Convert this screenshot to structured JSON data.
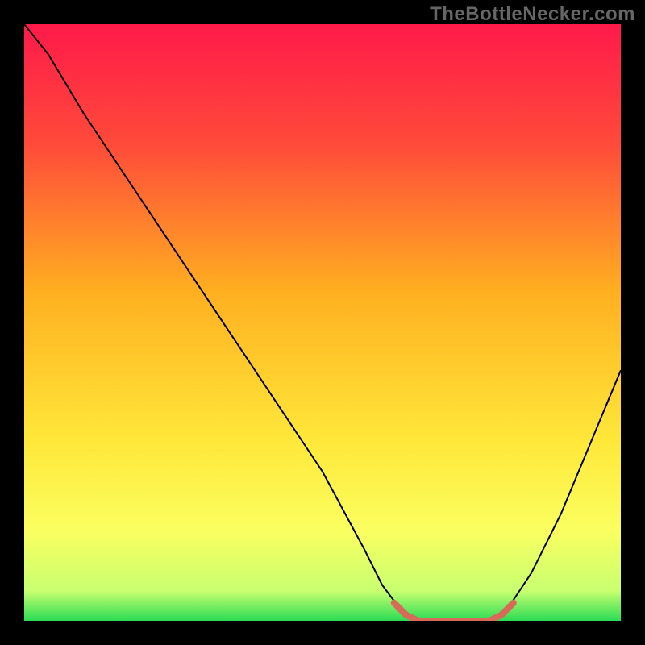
{
  "watermark": "TheBottleNecker.com",
  "chart_data": {
    "type": "line",
    "title": "",
    "xlabel": "",
    "ylabel": "",
    "xlim": [
      0,
      100
    ],
    "ylim": [
      0,
      100
    ],
    "gradient_stops": [
      {
        "offset": 0,
        "color": "#ff1a4a"
      },
      {
        "offset": 20,
        "color": "#ff4a3a"
      },
      {
        "offset": 45,
        "color": "#ffb020"
      },
      {
        "offset": 70,
        "color": "#ffe83a"
      },
      {
        "offset": 85,
        "color": "#faff60"
      },
      {
        "offset": 95,
        "color": "#c8ff70"
      },
      {
        "offset": 100,
        "color": "#2bdc55"
      }
    ],
    "series": [
      {
        "name": "bottleneck-curve",
        "stroke": "#000000",
        "stroke_width": 2,
        "points": [
          {
            "x": 0,
            "y": 100
          },
          {
            "x": 4,
            "y": 95
          },
          {
            "x": 10,
            "y": 85
          },
          {
            "x": 20,
            "y": 70
          },
          {
            "x": 30,
            "y": 55
          },
          {
            "x": 40,
            "y": 40
          },
          {
            "x": 50,
            "y": 25
          },
          {
            "x": 57,
            "y": 12
          },
          {
            "x": 60,
            "y": 6
          },
          {
            "x": 63,
            "y": 2
          },
          {
            "x": 66,
            "y": 0
          },
          {
            "x": 78,
            "y": 0
          },
          {
            "x": 81,
            "y": 2
          },
          {
            "x": 85,
            "y": 8
          },
          {
            "x": 90,
            "y": 18
          },
          {
            "x": 95,
            "y": 30
          },
          {
            "x": 100,
            "y": 42
          }
        ]
      }
    ],
    "highlight": {
      "name": "optimal-range",
      "stroke": "#d86a5a",
      "stroke_width": 8,
      "points": [
        {
          "x": 62,
          "y": 3
        },
        {
          "x": 64,
          "y": 1
        },
        {
          "x": 66,
          "y": 0
        },
        {
          "x": 78,
          "y": 0
        },
        {
          "x": 80,
          "y": 1
        },
        {
          "x": 82,
          "y": 3
        }
      ]
    }
  }
}
